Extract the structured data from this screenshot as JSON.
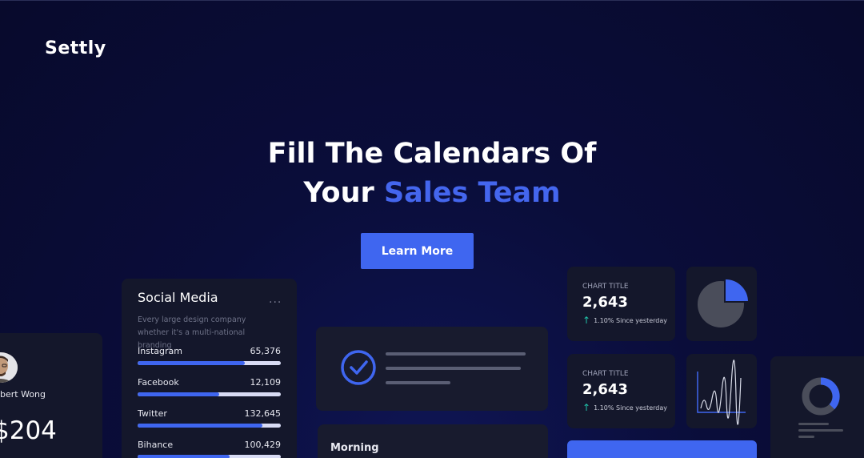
{
  "brand": {
    "logo": "Settly"
  },
  "hero": {
    "line1": "Fill The Calendars Of",
    "line2_plain": "Your ",
    "line2_accent": "Sales Team",
    "cta": "Learn More"
  },
  "profile_card": {
    "name": "bert Wong",
    "amount": "$204"
  },
  "social_card": {
    "title": "Social Media",
    "more": "...",
    "description": "Every large design company whether it's a multi-national branding",
    "rows": [
      {
        "name": "Instagram",
        "count": "65,376",
        "progress": 0.75
      },
      {
        "name": "Facebook",
        "count": "12,109",
        "progress": 0.57
      },
      {
        "name": "Twitter",
        "count": "132,645",
        "progress": 0.87
      },
      {
        "name": "Bihance",
        "count": "100,429",
        "progress": 0.64
      }
    ]
  },
  "morning_card": {
    "label": "Morning"
  },
  "stat_cards": [
    {
      "label": "CHART TITLE",
      "value": "2,643",
      "trend": "1.10% Since yesterday"
    },
    {
      "label": "CHART TITLE",
      "value": "2,643",
      "trend": "1.10% Since yesterday"
    }
  ],
  "colors": {
    "accent": "#3f66f0",
    "background": "#0a0d3a",
    "card": "#14172b",
    "trend_up": "#20c0a8"
  },
  "icons": {
    "check": "check-circle-icon",
    "trend": "arrow-up-icon",
    "pie": "pie-chart-icon",
    "line": "line-chart-icon",
    "donut": "donut-chart-icon"
  }
}
